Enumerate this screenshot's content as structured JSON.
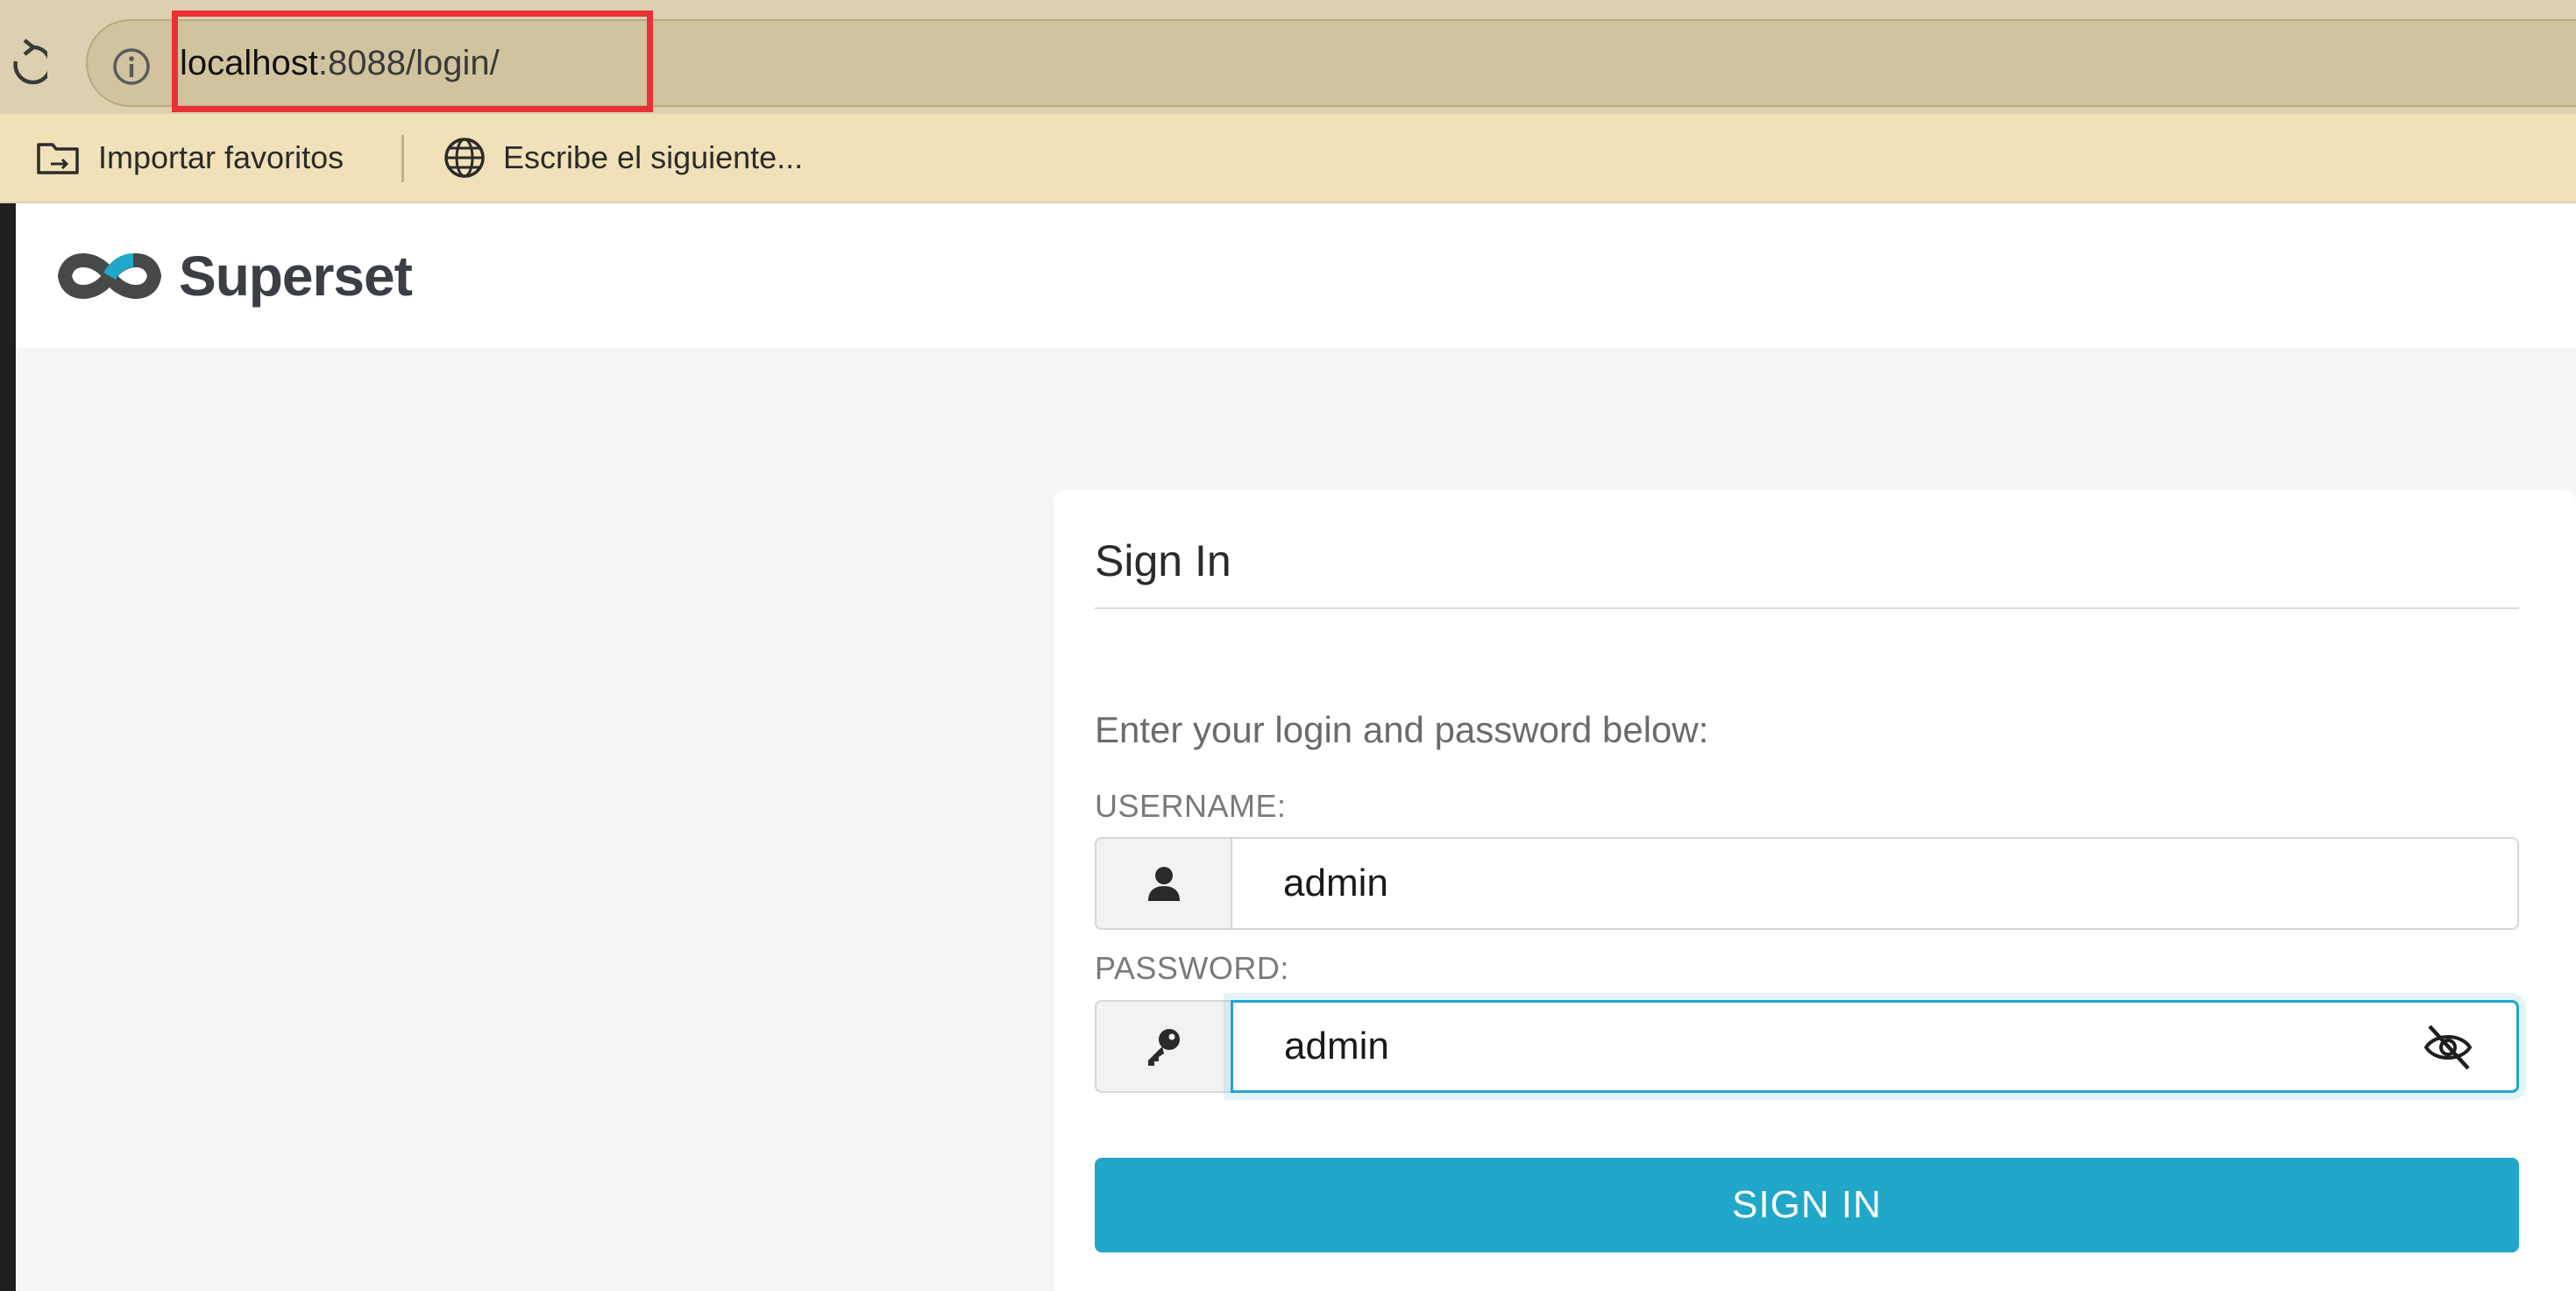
{
  "browser": {
    "url_host": "localhost",
    "url_path": ":8088/login/",
    "bookmarks": [
      {
        "label": "Importar favoritos",
        "icon": "import-folder-icon"
      },
      {
        "label": "Escribe el siguiente...",
        "icon": "globe-icon"
      }
    ],
    "highlight_color": "#ea3137"
  },
  "app": {
    "name": "Superset",
    "accent_color": "#20a7c9"
  },
  "login": {
    "title": "Sign In",
    "subtitle": "Enter your login and password below:",
    "username_label": "USERNAME:",
    "username_value": "admin",
    "password_label": "PASSWORD:",
    "password_value": "admin",
    "submit_label": "SIGN IN"
  }
}
